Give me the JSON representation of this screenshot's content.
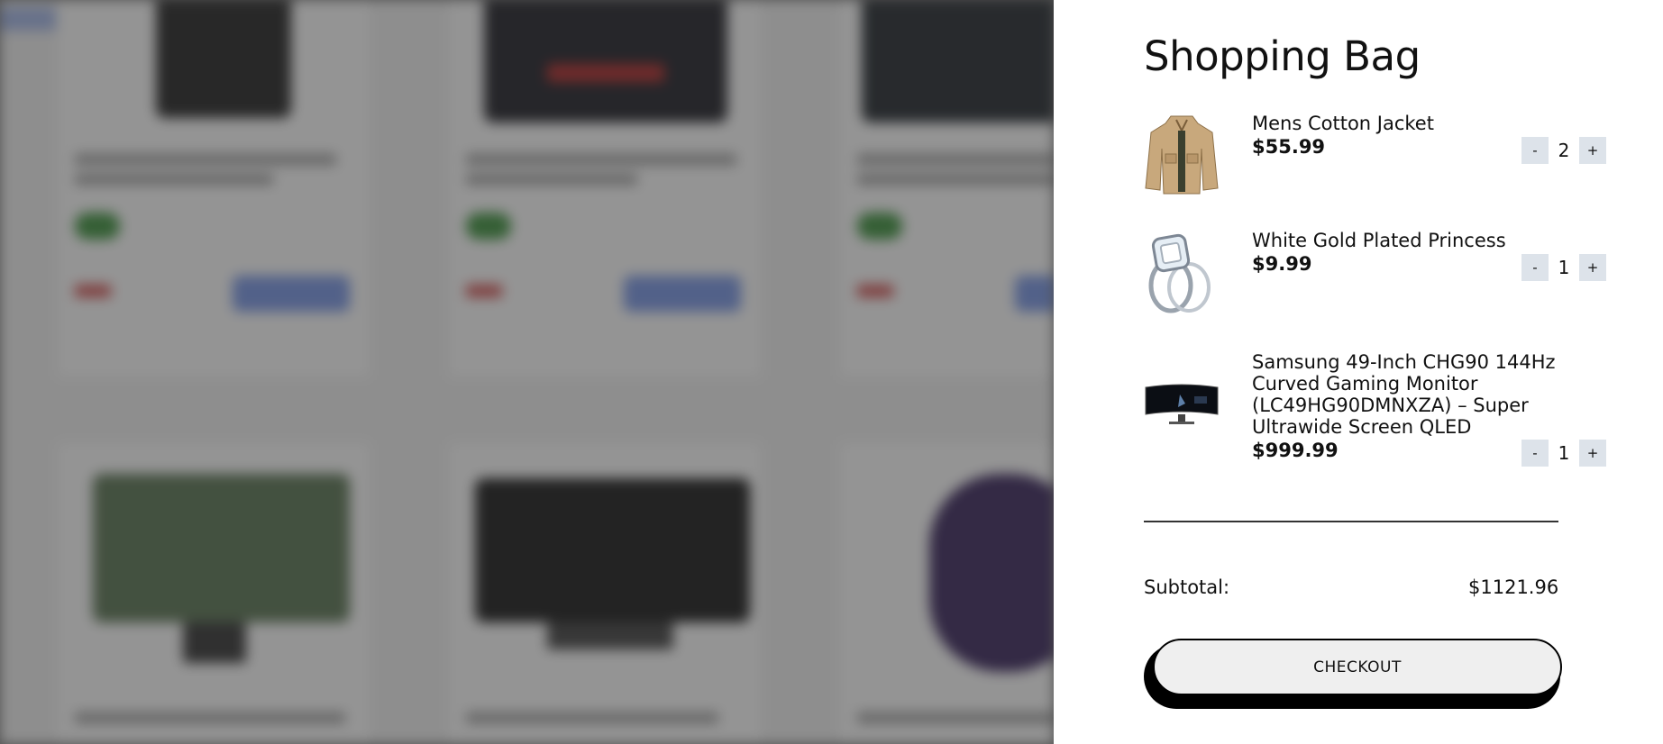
{
  "drawer": {
    "title": "Shopping Bag",
    "items": [
      {
        "name": "Mens Cotton Jacket",
        "price": "$55.99",
        "quantity": "2",
        "minus": "-",
        "plus": "+",
        "thumb_icon": "jacket-thumbnail"
      },
      {
        "name": "White Gold Plated Princess",
        "price": "$9.99",
        "quantity": "1",
        "minus": "-",
        "plus": "+",
        "thumb_icon": "ring-thumbnail"
      },
      {
        "name": "Samsung 49-Inch CHG90 144Hz Curved Gaming Monitor (LC49HG90DMNXZA) – Super Ultrawide Screen QLED",
        "price": "$999.99",
        "quantity": "1",
        "minus": "-",
        "plus": "+",
        "thumb_icon": "monitor-thumbnail"
      }
    ],
    "subtotal_label": "Subtotal:",
    "subtotal_value": "$1121.96",
    "checkout_label": "CHECKOUT"
  },
  "colors": {
    "overlay": "#6b6b6b",
    "drawer_bg": "#ffffff",
    "qty_button_bg": "#dde3ea",
    "checkout_bg": "#efefef",
    "checkout_shadow": "#000000"
  }
}
